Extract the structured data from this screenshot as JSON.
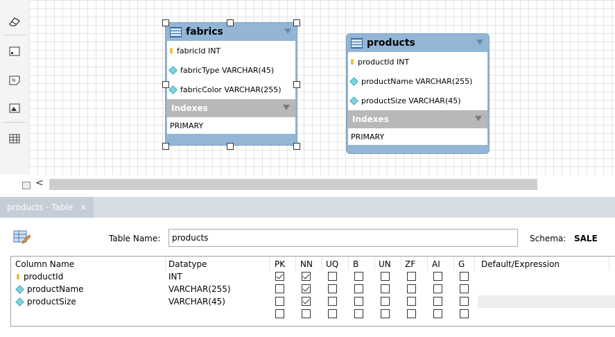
{
  "toolbar": {
    "icons": [
      "eraser-icon",
      "text-object-icon",
      "note-icon",
      "image-icon",
      "table-icon"
    ]
  },
  "diagram": {
    "entities": [
      {
        "name": "fabrics",
        "columns": [
          {
            "label": "fabricId INT",
            "kind": "primary-key"
          },
          {
            "label": "fabricType VARCHAR(45)",
            "kind": "column"
          },
          {
            "label": "fabricColor VARCHAR(255)",
            "kind": "column"
          }
        ],
        "indexes_label": "Indexes",
        "indexes": [
          "PRIMARY"
        ],
        "selected": true
      },
      {
        "name": "products",
        "columns": [
          {
            "label": "productId INT",
            "kind": "primary-key"
          },
          {
            "label": "productName VARCHAR(255)",
            "kind": "column"
          },
          {
            "label": "productSize VARCHAR(45)",
            "kind": "column"
          }
        ],
        "indexes_label": "Indexes",
        "indexes": [
          "PRIMARY"
        ],
        "selected": false
      }
    ]
  },
  "scrollbar": {
    "left_arrow": "<"
  },
  "editor_tab": {
    "label": "products - Table",
    "close": "×"
  },
  "editor": {
    "table_name_label": "Table Name:",
    "table_name_value": "products",
    "schema_label": "Schema:",
    "schema_value": "SALE",
    "columns_header": {
      "name": "Column Name",
      "datatype": "Datatype",
      "flags": [
        "PK",
        "NN",
        "UQ",
        "B",
        "UN",
        "ZF",
        "AI",
        "G"
      ],
      "default": "Default/Expression"
    },
    "rows": [
      {
        "name": "productId",
        "datatype": "INT",
        "kind": "primary-key",
        "flags": [
          true,
          true,
          false,
          false,
          false,
          false,
          false,
          false
        ]
      },
      {
        "name": "productName",
        "datatype": "VARCHAR(255)",
        "kind": "column",
        "flags": [
          false,
          true,
          false,
          false,
          false,
          false,
          false,
          false
        ]
      },
      {
        "name": "productSize",
        "datatype": "VARCHAR(45)",
        "kind": "column",
        "flags": [
          false,
          true,
          false,
          false,
          false,
          false,
          false,
          false
        ]
      },
      {
        "name": "",
        "datatype": "",
        "kind": "empty",
        "flags": [
          false,
          false,
          false,
          false,
          false,
          false,
          false,
          false
        ]
      }
    ]
  }
}
